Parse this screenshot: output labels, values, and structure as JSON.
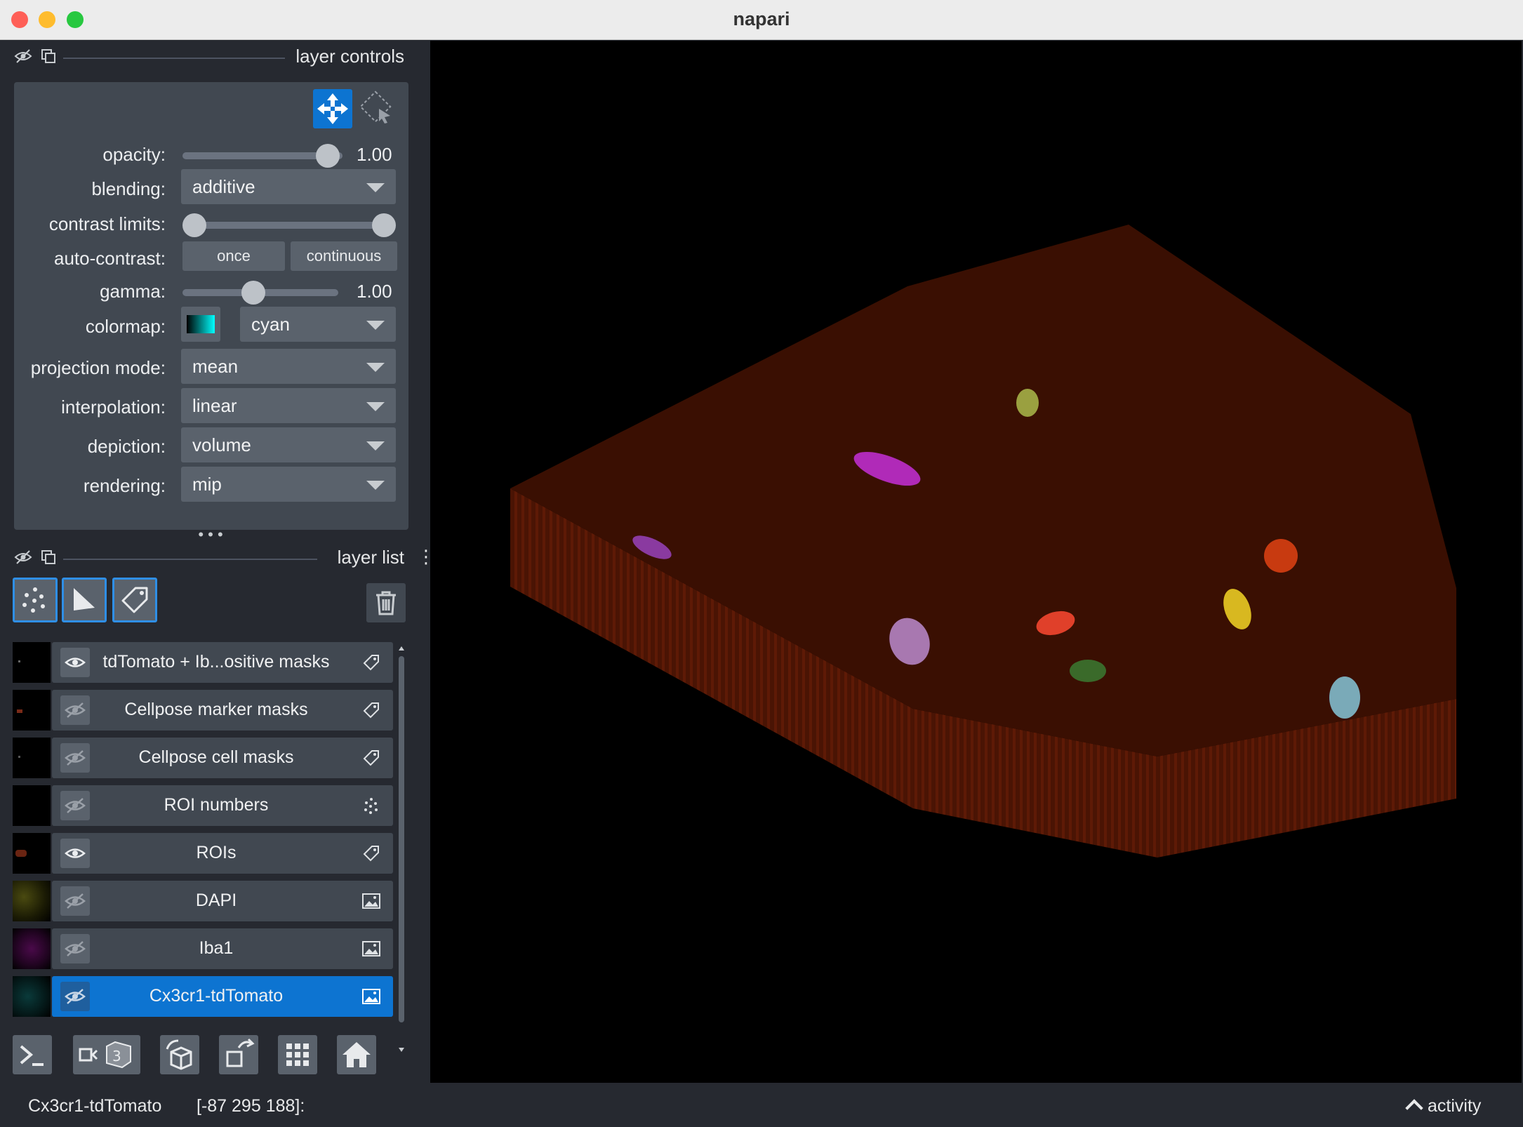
{
  "window": {
    "title": "napari"
  },
  "layer_controls": {
    "header": "layer controls",
    "opacity": {
      "label": "opacity:",
      "value": "1.00",
      "level": 1.0
    },
    "blending": {
      "label": "blending:",
      "value": "additive"
    },
    "contrast_limits": {
      "label": "contrast limits:"
    },
    "auto_contrast": {
      "label": "auto-contrast:",
      "once": "once",
      "continuous": "continuous"
    },
    "gamma": {
      "label": "gamma:",
      "value": "1.00",
      "level": 0.45
    },
    "colormap": {
      "label": "colormap:",
      "value": "cyan"
    },
    "projection_mode": {
      "label": "projection mode:",
      "value": "mean"
    },
    "interpolation": {
      "label": "interpolation:",
      "value": "linear"
    },
    "depiction": {
      "label": "depiction:",
      "value": "volume"
    },
    "rendering": {
      "label": "rendering:",
      "value": "mip"
    }
  },
  "layer_list": {
    "header": "layer list",
    "layers": [
      {
        "name": "tdTomato + Ib...ositive masks",
        "type_icon": "label-icon",
        "visible": true
      },
      {
        "name": "Cellpose marker masks",
        "type_icon": "label-icon",
        "visible": false
      },
      {
        "name": "Cellpose cell masks",
        "type_icon": "label-icon",
        "visible": false
      },
      {
        "name": "ROI numbers",
        "type_icon": "points-icon",
        "visible": false
      },
      {
        "name": "ROIs",
        "type_icon": "label-icon",
        "visible": true
      },
      {
        "name": "DAPI",
        "type_icon": "image-icon",
        "visible": false
      },
      {
        "name": "Iba1",
        "type_icon": "image-icon",
        "visible": false
      },
      {
        "name": "Cx3cr1-tdTomato",
        "type_icon": "image-icon",
        "visible": false,
        "selected": true
      }
    ]
  },
  "status": {
    "layer": "Cx3cr1-tdTomato",
    "coords": "[-87 295 188]:",
    "activity": "activity"
  },
  "colors": {
    "accent": "#0d74d1",
    "panel": "#262930",
    "control_bg": "#414851"
  }
}
